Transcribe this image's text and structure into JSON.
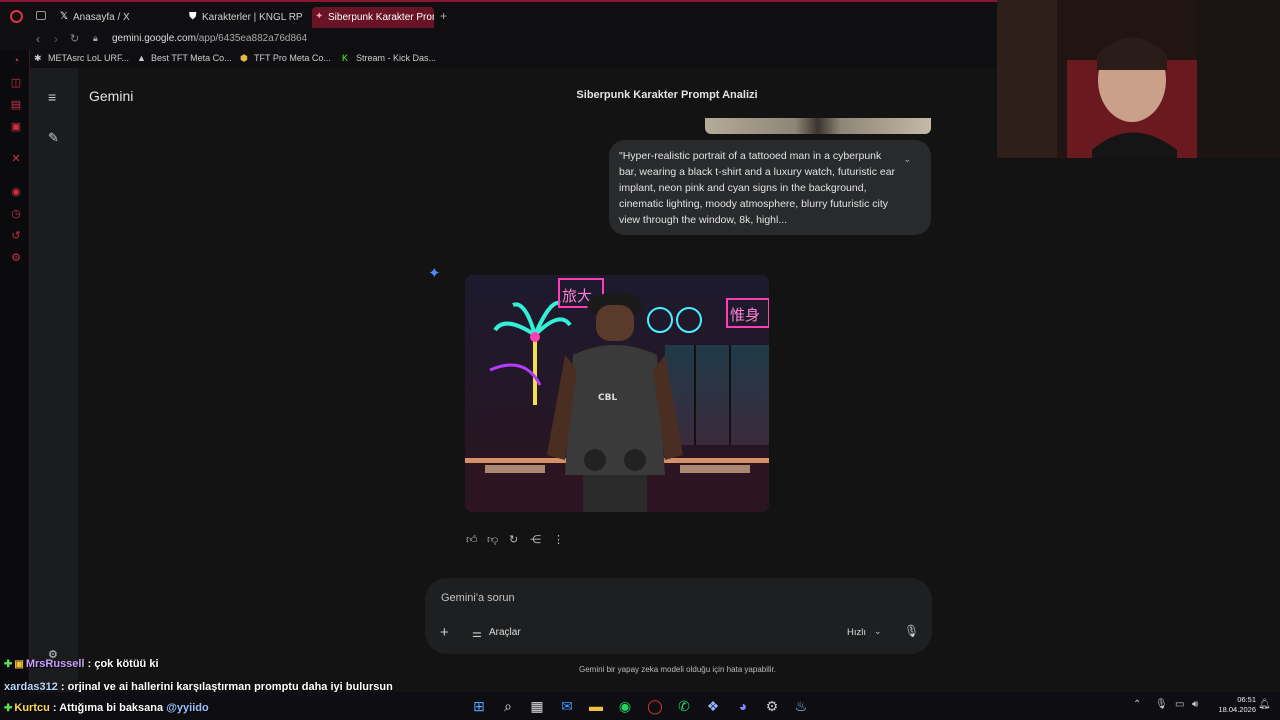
{
  "browser": {
    "tabs": [
      {
        "label": "Anasayfa / X",
        "icon": "x-logo-icon"
      },
      {
        "label": "Karakterler | KNGL RP",
        "icon": "shield-icon"
      },
      {
        "label": "Siberpunk Karakter Prompt",
        "icon": "gemini-spark-icon",
        "active": true
      }
    ],
    "new_tab": "+",
    "url_host": "gemini.google.com",
    "url_path": "/app/6435ea882a76d864",
    "bookmarks": [
      {
        "label": "METAsrc LoL URF...",
        "icon": "metasrc-icon"
      },
      {
        "label": "Best TFT Meta Co...",
        "icon": "tft-icon"
      },
      {
        "label": "TFT Pro Meta Co...",
        "icon": "tft-pro-icon"
      },
      {
        "label": "Stream - Kick Das...",
        "icon": "kick-icon"
      }
    ]
  },
  "gemini": {
    "brand": "Gemini",
    "conversation_title": "Siberpunk Karakter Prompt Analizi",
    "user_prompt": "\"Hyper-realistic portrait of a tattooed man in a cyberpunk bar, wearing a black t-shirt and a luxury watch, futuristic ear implant, neon pink and cyan signs in the background, cinematic lighting, moody atmosphere, blurry futuristic city view through the window, 8k, highl...",
    "neon_sign_text_1": "旅大",
    "neon_sign_text_2": "惟身",
    "composer_placeholder": "Gemini'a sorun",
    "tools_label": "Araçlar",
    "model_label": "Hızlı",
    "disclaimer": "Gemini bir yapay zeka modeli olduğu için hata yapabilir."
  },
  "chat": [
    {
      "user": "MrsRussell",
      "message": " : çok kötüü ki"
    },
    {
      "user": "xardas312",
      "message": " : orjinal ve ai hallerini karşılaştırman promptu daha iyi bulursun"
    },
    {
      "user": "Kurtcu",
      "message": " : Attığıma bi baksana ",
      "mention": "@yyiido"
    }
  ],
  "taskbar": {
    "time": "06:51",
    "date": "18.04.2026"
  },
  "colors": {
    "accent_red": "#d02f47",
    "gemini_blue": "#4a8cff",
    "bubble_bg": "#282a2c"
  }
}
